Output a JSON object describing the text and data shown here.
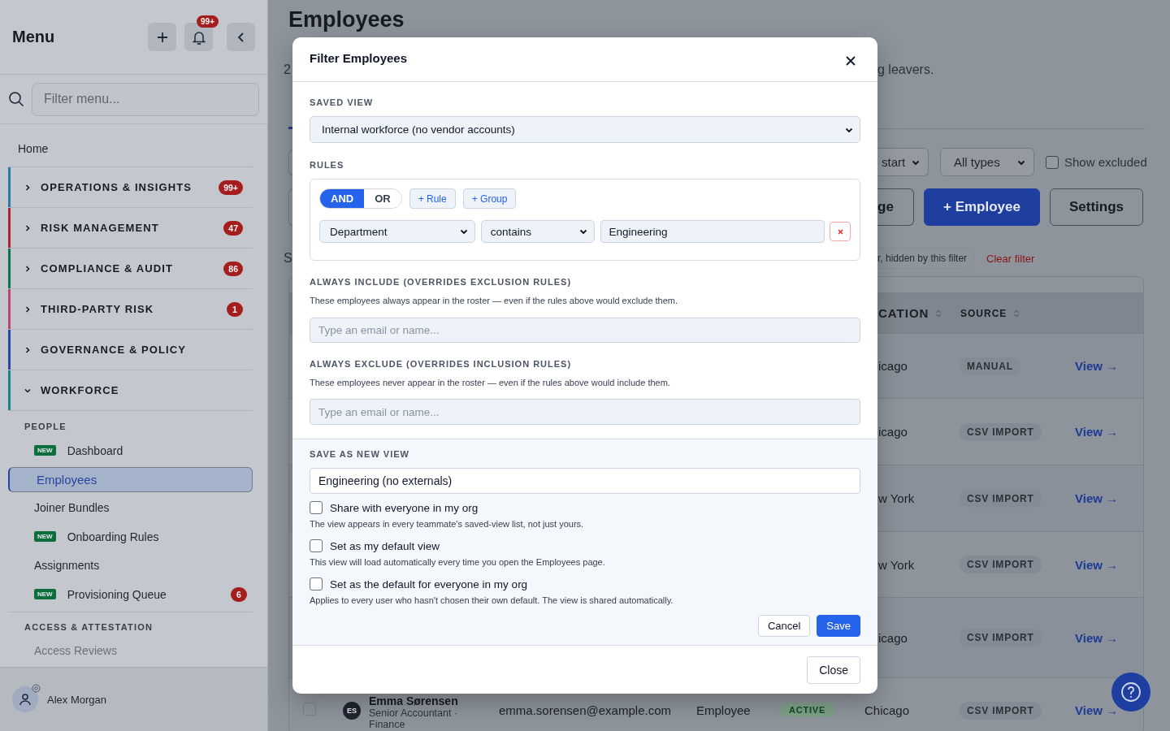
{
  "sidebar": {
    "title": "Menu",
    "notification_count": "99+",
    "search": {
      "placeholder": "Filter menu..."
    },
    "home": "Home",
    "groups": [
      {
        "label": "OPERATIONS & INSIGHTS",
        "color": "#2a7aa8",
        "count": "99+",
        "expanded": false
      },
      {
        "label": "RISK MANAGEMENT",
        "color": "#a82a2a",
        "count": "47",
        "expanded": false
      },
      {
        "label": "COMPLIANCE & AUDIT",
        "color": "#0d7550",
        "count": "86",
        "expanded": false
      },
      {
        "label": "THIRD-PARTY RISK",
        "color": "#b8466e",
        "count": "1",
        "expanded": false
      },
      {
        "label": "GOVERNANCE & POLICY",
        "color": "#2b46a4",
        "expanded": false
      },
      {
        "label": "WORKFORCE",
        "color": "#1a8289",
        "expanded": true,
        "sections": [
          {
            "title": "PEOPLE",
            "items": [
              {
                "label": "Dashboard",
                "tag": "NEW",
                "selected": false,
                "disabled": false
              },
              {
                "label": "Employees",
                "selected": true,
                "disabled": false
              },
              {
                "label": "Joiner Bundles",
                "selected": false,
                "disabled": false
              },
              {
                "label": "Onboarding Rules",
                "tag": "NEW",
                "selected": false,
                "disabled": false
              },
              {
                "label": "Assignments",
                "selected": false,
                "disabled": false
              },
              {
                "label": "Provisioning Queue",
                "tag": "NEW",
                "count": "6",
                "selected": false,
                "disabled": false
              }
            ]
          },
          {
            "title": "ACCESS & ATTESTATION",
            "items": [
              {
                "label": "Access Reviews",
                "selected": false,
                "disabled": true
              }
            ]
          }
        ]
      }
    ],
    "user": {
      "name": "Alex Morgan"
    }
  },
  "page": {
    "title": "Employees",
    "subtitle_start": "2",
    "subtitle_end": "g leavers.",
    "left_fragment": "S",
    "filters": {
      "date_select": "start",
      "type_select": "All types",
      "show_excluded": {
        "label": "Show excluded",
        "checked": false
      }
    },
    "buttons": [
      {
        "label": "ge",
        "kind": "secondary"
      },
      {
        "label": "+ Employee",
        "kind": "primary"
      },
      {
        "label": "Settings",
        "kind": "secondary"
      }
    ],
    "filter_chip": "r, hidden by this filter",
    "clear_filter": "Clear filter",
    "table": {
      "columns": [
        "CATION",
        "SOURCE"
      ],
      "rows": [
        {
          "kind": "partial",
          "location": "icago",
          "source": "MANUAL",
          "action": "View →"
        },
        {
          "kind": "partial",
          "location": "icago",
          "source": "CSV IMPORT",
          "action": "View →"
        },
        {
          "kind": "partial",
          "location": "w York",
          "source": "CSV IMPORT",
          "action": "View →"
        },
        {
          "kind": "partial",
          "location": "w York",
          "source": "CSV IMPORT",
          "action": "View →"
        },
        {
          "kind": "partial",
          "location": "icago",
          "source": "CSV IMPORT",
          "action": "View →"
        },
        {
          "kind": "full",
          "selected": false,
          "initials": "ES",
          "name": "Emma Sørensen",
          "title": "Senior Accountant · Finance",
          "email": "emma.sorensen@example.com",
          "type": "Employee",
          "status": "ACTIVE",
          "location": "Chicago",
          "source": "CSV IMPORT",
          "action": "View →"
        }
      ]
    }
  },
  "modal": {
    "title": "Filter Employees",
    "saved_view": {
      "label": "SAVED VIEW",
      "value": "Internal workforce (no vendor accounts)"
    },
    "rules": {
      "label": "RULES",
      "operators": [
        {
          "label": "AND",
          "selected": true
        },
        {
          "label": "OR",
          "selected": false
        }
      ],
      "add_buttons": [
        "+ Rule",
        "+ Group"
      ],
      "conditions": [
        {
          "field": "Department",
          "operator": "contains",
          "value": "Engineering"
        }
      ]
    },
    "lists": [
      {
        "label": "ALWAYS INCLUDE (OVERRIDES EXCLUSION RULES)",
        "description": "These employees always appear in the roster — even if the rules above would exclude them.",
        "placeholder": "Type an email or name..."
      },
      {
        "label": "ALWAYS EXCLUDE (OVERRIDES INCLUSION RULES)",
        "description": "These employees never appear in the roster — even if the rules above would include them.",
        "placeholder": "Type an email or name..."
      }
    ],
    "save_view": {
      "label": "SAVE AS NEW VIEW",
      "name": "Engineering (no externals)",
      "options": [
        {
          "label": "Share with everyone in my org",
          "hint": "The view appears in every teammate's saved-view list, not just yours.",
          "checked": false
        },
        {
          "label": "Set as my default view",
          "hint": "This view will load automatically every time you open the Employees page.",
          "checked": false
        },
        {
          "label": "Set as the default for everyone in my org",
          "hint": "Applies to every user who hasn't chosen their own default. The view is shared automatically.",
          "checked": false
        }
      ],
      "buttons": [
        {
          "label": "Cancel",
          "kind": "secondary"
        },
        {
          "label": "Save",
          "kind": "primary"
        }
      ]
    },
    "footer_button": "Close"
  }
}
